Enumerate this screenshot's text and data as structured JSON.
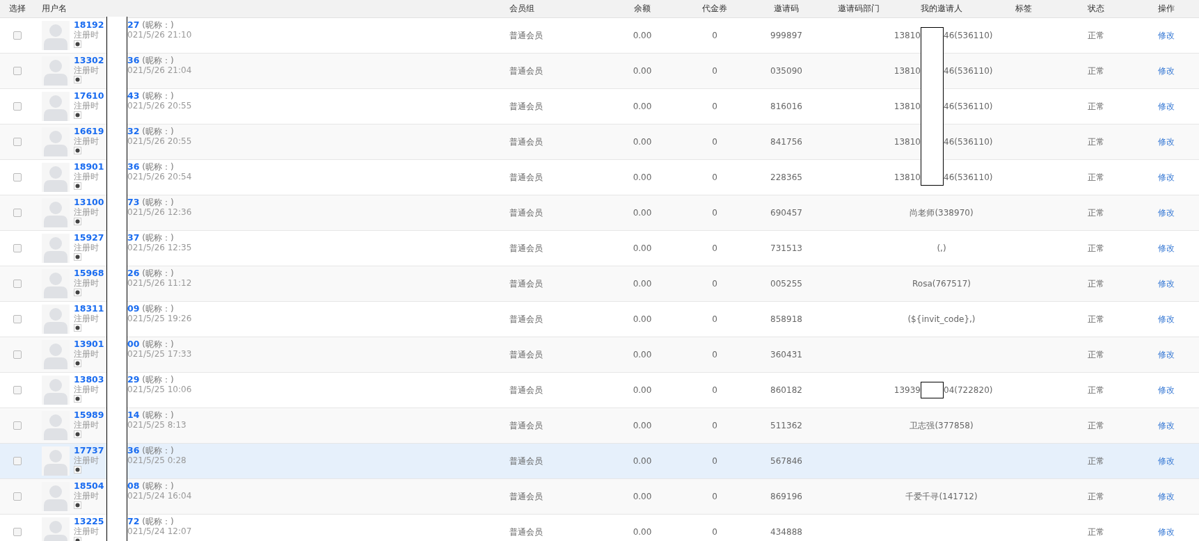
{
  "columns": [
    "选择",
    "用户名",
    "会员组",
    "余额",
    "代金券",
    "邀请码",
    "邀请码部门",
    "我的邀请人",
    "标签",
    "状态",
    "操作"
  ],
  "rows": [
    {
      "checked": false,
      "highlighted": false,
      "name_parts": [
        "18192",
        "27"
      ],
      "nickname": "(昵称：)",
      "registered_parts": [
        "注册时",
        "021/5/26 21:10"
      ],
      "group": "普通会员",
      "balance": "0.00",
      "vouchers": "0",
      "invite_code": "999897",
      "inviter_parts": [
        "13810",
        "46(536110)"
      ],
      "status": "正常",
      "action": "修改"
    },
    {
      "checked": false,
      "highlighted": false,
      "name_parts": [
        "13302",
        "36"
      ],
      "nickname": "(昵称：)",
      "registered_parts": [
        "注册时",
        "021/5/26 21:04"
      ],
      "group": "普通会员",
      "balance": "0.00",
      "vouchers": "0",
      "invite_code": "035090",
      "inviter_parts": [
        "13810",
        "46(536110)"
      ],
      "status": "正常",
      "action": "修改"
    },
    {
      "checked": false,
      "highlighted": false,
      "name_parts": [
        "17610",
        "43"
      ],
      "nickname": "(昵称：)",
      "registered_parts": [
        "注册时",
        "021/5/26 20:55"
      ],
      "group": "普通会员",
      "balance": "0.00",
      "vouchers": "0",
      "invite_code": "816016",
      "inviter_parts": [
        "13810",
        "46(536110)"
      ],
      "status": "正常",
      "action": "修改"
    },
    {
      "checked": false,
      "highlighted": false,
      "name_parts": [
        "16619",
        "32"
      ],
      "nickname": "(昵称：)",
      "registered_parts": [
        "注册时",
        "021/5/26 20:55"
      ],
      "group": "普通会员",
      "balance": "0.00",
      "vouchers": "0",
      "invite_code": "841756",
      "inviter_parts": [
        "13810",
        "46(536110)"
      ],
      "status": "正常",
      "action": "修改"
    },
    {
      "checked": false,
      "highlighted": false,
      "name_parts": [
        "18901",
        "36"
      ],
      "nickname": "(昵称：)",
      "registered_parts": [
        "注册时",
        "021/5/26 20:54"
      ],
      "group": "普通会员",
      "balance": "0.00",
      "vouchers": "0",
      "invite_code": "228365",
      "inviter_parts": [
        "13810",
        "46(536110)"
      ],
      "status": "正常",
      "action": "修改"
    },
    {
      "checked": false,
      "highlighted": false,
      "name_parts": [
        "13100",
        "73"
      ],
      "nickname": "(昵称：)",
      "registered_parts": [
        "注册时",
        "021/5/26 12:36"
      ],
      "group": "普通会员",
      "balance": "0.00",
      "vouchers": "0",
      "invite_code": "690457",
      "inviter_parts": [
        "尚老师(338970)"
      ],
      "status": "正常",
      "action": "修改"
    },
    {
      "checked": false,
      "highlighted": false,
      "name_parts": [
        "15927",
        "37"
      ],
      "nickname": "(昵称：)",
      "registered_parts": [
        "注册时",
        "021/5/26 12:35"
      ],
      "group": "普通会员",
      "balance": "0.00",
      "vouchers": "0",
      "invite_code": "731513",
      "inviter_parts": [
        "(,)"
      ],
      "status": "正常",
      "action": "修改"
    },
    {
      "checked": false,
      "highlighted": false,
      "name_parts": [
        "15968",
        "26"
      ],
      "nickname": "(昵称：)",
      "registered_parts": [
        "注册时",
        "021/5/26 11:12"
      ],
      "group": "普通会员",
      "balance": "0.00",
      "vouchers": "0",
      "invite_code": "005255",
      "inviter_parts": [
        "Rosa(767517)"
      ],
      "status": "正常",
      "action": "修改"
    },
    {
      "checked": false,
      "highlighted": false,
      "name_parts": [
        "18311",
        "09"
      ],
      "nickname": "(昵称：)",
      "registered_parts": [
        "注册时",
        "021/5/25 19:26"
      ],
      "group": "普通会员",
      "balance": "0.00",
      "vouchers": "0",
      "invite_code": "858918",
      "inviter_parts": [
        "(${invit_code},)"
      ],
      "status": "正常",
      "action": "修改"
    },
    {
      "checked": false,
      "highlighted": false,
      "name_parts": [
        "13901",
        "00"
      ],
      "nickname": "(昵称：)",
      "registered_parts": [
        "注册时",
        "021/5/25 17:33"
      ],
      "group": "普通会员",
      "balance": "0.00",
      "vouchers": "0",
      "invite_code": "360431",
      "status": "正常",
      "action": "修改"
    },
    {
      "checked": false,
      "highlighted": false,
      "name_parts": [
        "13803",
        "29"
      ],
      "nickname": "(昵称：)",
      "registered_parts": [
        "注册时",
        "021/5/25 10:06"
      ],
      "group": "普通会员",
      "balance": "0.00",
      "vouchers": "0",
      "invite_code": "860182",
      "inviter_parts": [
        "13939",
        "04(722820)"
      ],
      "status": "正常",
      "action": "修改"
    },
    {
      "checked": false,
      "highlighted": false,
      "name_parts": [
        "15989",
        "14"
      ],
      "nickname": "(昵称：)",
      "registered_parts": [
        "注册时",
        "021/5/25 8:13"
      ],
      "group": "普通会员",
      "balance": "0.00",
      "vouchers": "0",
      "invite_code": "511362",
      "inviter_parts": [
        "卫志强(377858)"
      ],
      "status": "正常",
      "action": "修改"
    },
    {
      "checked": false,
      "highlighted": true,
      "name_parts": [
        "17737",
        "36"
      ],
      "nickname": "(昵称：)",
      "registered_parts": [
        "注册时",
        "021/5/25 0:28"
      ],
      "group": "普通会员",
      "balance": "0.00",
      "vouchers": "0",
      "invite_code": "567846",
      "status": "正常",
      "action": "修改"
    },
    {
      "checked": false,
      "highlighted": false,
      "name_parts": [
        "18504",
        "08"
      ],
      "nickname": "(昵称：)",
      "registered_parts": [
        "注册时",
        "021/5/24 16:04"
      ],
      "group": "普通会员",
      "balance": "0.00",
      "vouchers": "0",
      "invite_code": "869196",
      "inviter_parts": [
        "千爱千寻(141712)"
      ],
      "status": "正常",
      "action": "修改"
    },
    {
      "checked": false,
      "highlighted": false,
      "name_parts": [
        "13225",
        "72"
      ],
      "nickname": "(昵称：)",
      "registered_parts": [
        "注册时",
        "021/5/24 12:07"
      ],
      "group": "普通会员",
      "balance": "0.00",
      "vouchers": "0",
      "invite_code": "434888",
      "status": "正常",
      "action": "修改"
    }
  ]
}
